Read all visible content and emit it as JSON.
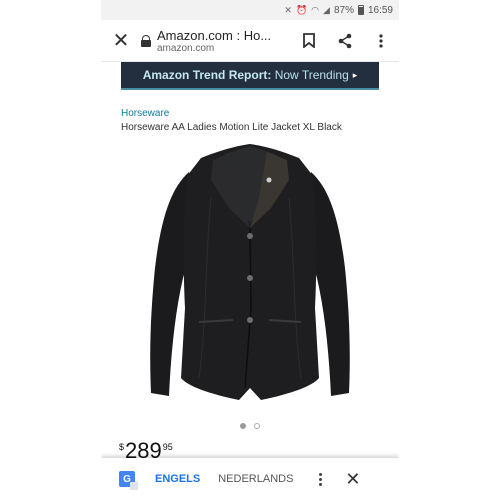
{
  "status_bar": {
    "battery": "87%",
    "time": "16:59"
  },
  "browser": {
    "title": "Amazon.com : Ho...",
    "url": "amazon.com",
    "icons": [
      "close-icon",
      "lock-icon",
      "bookmark-icon",
      "share-icon",
      "more-vert-icon"
    ]
  },
  "banner": {
    "strong": "Amazon Trend Report:",
    "rest": " Now Trending",
    "arrow": "▸"
  },
  "product": {
    "brand": "Horseware",
    "title": "Horseware AA Ladies Motion Lite Jacket XL Black",
    "image_pages": 2,
    "image_page_active": 1
  },
  "price": {
    "symbol": "$",
    "whole": "289",
    "fraction": "95"
  },
  "translate": {
    "source_lang": "ENGELS",
    "target_lang": "NEDERLANDS",
    "icons": [
      "google-translate-icon",
      "more-vert-icon",
      "close-icon"
    ]
  },
  "colors": {
    "banner_bg": "#232f3e",
    "brand_link": "#0f7aa3",
    "translate_active": "#1a73e8"
  }
}
